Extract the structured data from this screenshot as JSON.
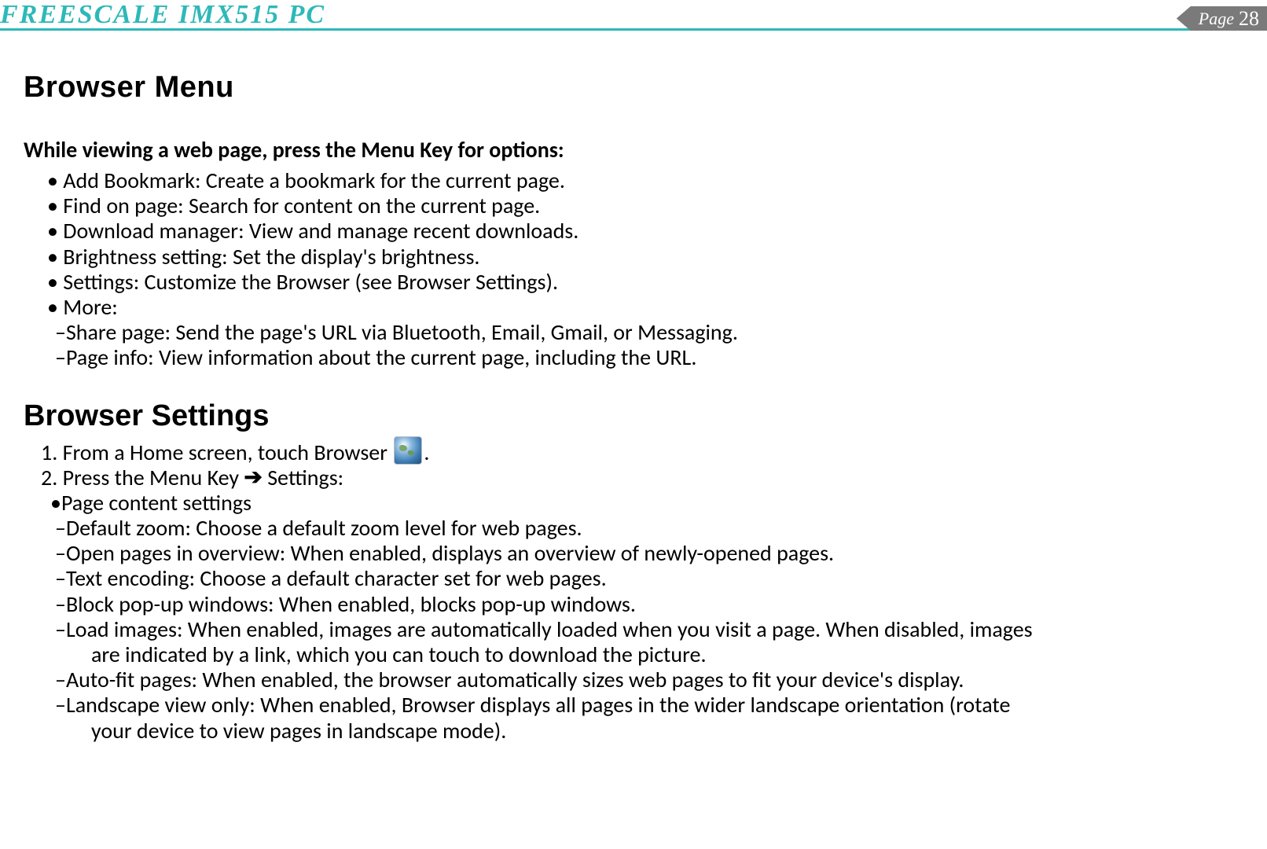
{
  "header": {
    "title": "FREESCALE  IMX515  PC",
    "page_label": "Page",
    "page_number": "28"
  },
  "section1": {
    "heading": "Browser Menu",
    "lead": "While viewing a web page, press the Menu Key  for options:",
    "bullets": [
      "• Add Bookmark:  Create a bookmark for the current page.",
      "• Find on page:  Search for content on the current page.",
      "• Download manager:  View and manage recent downloads.",
      "• Brightness setting:  Set the display's brightness.",
      "• Settings:  Customize the Browser (see Browser Settings).",
      "• More:"
    ],
    "more_sub": [
      "–Share page: Send the page's URL via Bluetooth, Email, Gmail, or Messaging.",
      "–Page info: View information about the current page, including the URL."
    ]
  },
  "section2": {
    "heading": "Browser Settings",
    "step1_pre": "1.  From a Home screen, touch Browser",
    "step1_post": ".",
    "step2_pre": "2.  Press the Menu Key  ",
    "step2_arrow": "➔",
    "step2_post": " Settings:",
    "subhead": "•Page content settings",
    "items": [
      "–Default zoom:  Choose a default zoom level for web pages.",
      "–Open pages in overview:  When enabled, displays an overview of newly-opened pages.",
      "–Text encoding:  Choose a default character set for web pages.",
      "–Block pop-up windows:  When enabled, blocks pop-up windows."
    ],
    "load_images_l1": "–Load images:  When enabled, images are automatically loaded when you visit a page. When disabled, images",
    "load_images_l2": "are indicated by a link, which you can touch to download the picture.",
    "autofit": "–Auto-fit pages:  When enabled, the browser automatically sizes web pages to fit your device's display.",
    "landscape_l1": "–Landscape view only: When enabled, Browser displays all pages in the wider landscape orientation (rotate",
    "landscape_l2": "your device to view pages in landscape mode)."
  }
}
